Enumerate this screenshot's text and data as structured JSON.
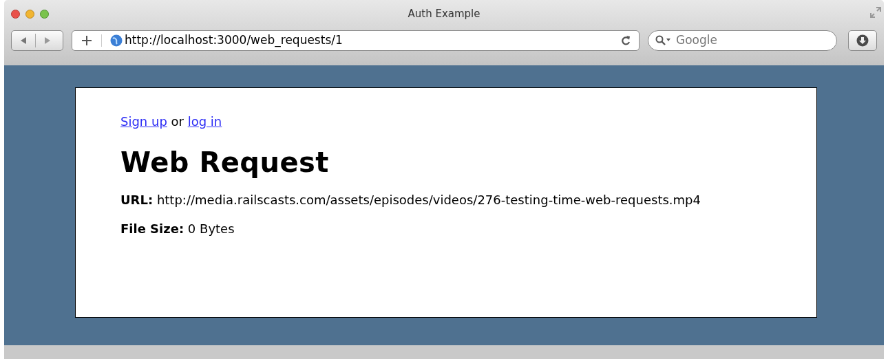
{
  "window": {
    "title": "Auth Example"
  },
  "toolbar": {
    "address": "http://localhost:3000/web_requests/1",
    "search": {
      "placeholder": "Google"
    }
  },
  "page": {
    "auth": {
      "links": [
        "Sign up",
        "log in"
      ],
      "separator": "or"
    },
    "heading": "Web Request",
    "fields": [
      {
        "label": "URL:",
        "value": "http://media.railscasts.com/assets/episodes/videos/276-testing-time-web-requests.mp4"
      },
      {
        "label": "File Size:",
        "value": "0 Bytes"
      }
    ]
  }
}
